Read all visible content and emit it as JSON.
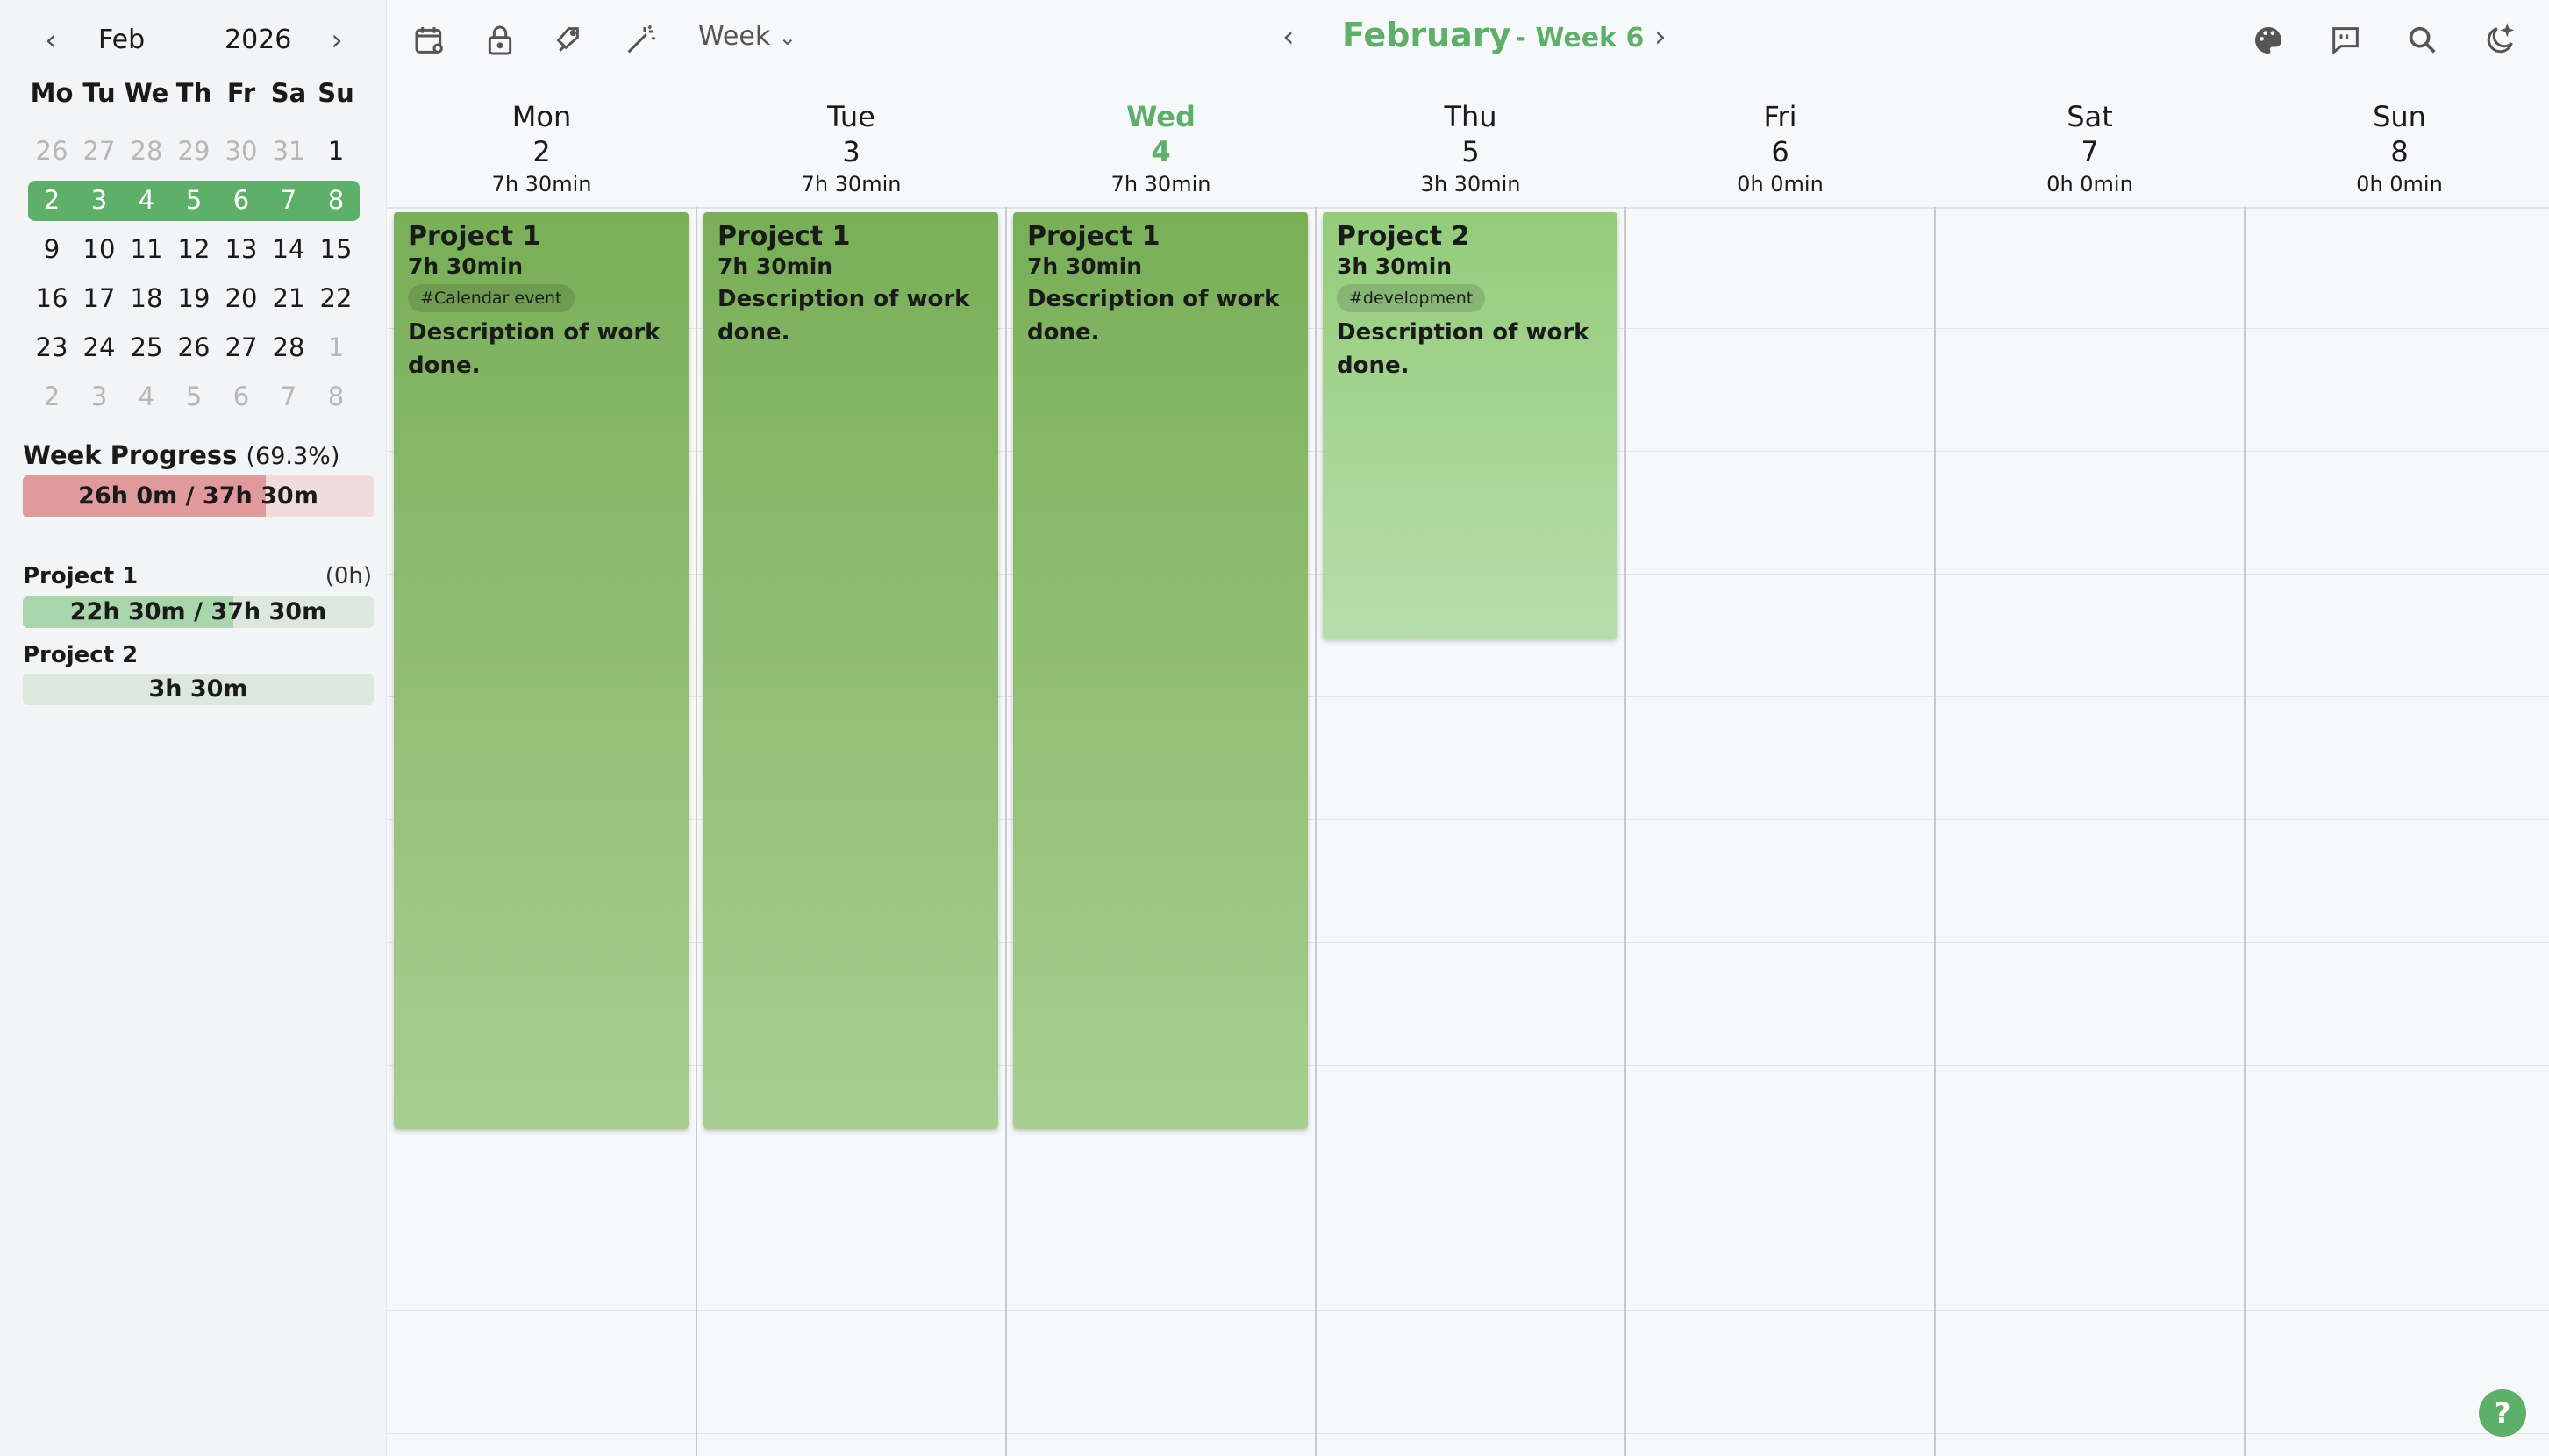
{
  "mini_calendar": {
    "month": "Feb",
    "year": "2026",
    "prev": "‹",
    "next": "›",
    "weekdays": [
      "Mo",
      "Tu",
      "We",
      "Th",
      "Fr",
      "Sa",
      "Su"
    ],
    "weeks": [
      [
        "26",
        "27",
        "28",
        "29",
        "30",
        "31",
        "1"
      ],
      [
        "2",
        "3",
        "4",
        "5",
        "6",
        "7",
        "8"
      ],
      [
        "9",
        "10",
        "11",
        "12",
        "13",
        "14",
        "15"
      ],
      [
        "16",
        "17",
        "18",
        "19",
        "20",
        "21",
        "22"
      ],
      [
        "23",
        "24",
        "25",
        "26",
        "27",
        "28",
        "1"
      ],
      [
        "2",
        "3",
        "4",
        "5",
        "6",
        "7",
        "8"
      ]
    ]
  },
  "progress": {
    "title": "Week Progress",
    "percent": "(69.3%)",
    "value": "26h 0m / 37h 30m",
    "fraction": 0.693,
    "color": "#e09a9c"
  },
  "projects": [
    {
      "name": "Project 1",
      "side": "(0h)",
      "value": "22h 30m / 37h 30m",
      "fraction": 0.6,
      "color": "#a8d5ab"
    },
    {
      "name": "Project 2",
      "side": "",
      "value": "3h 30m",
      "fraction": 0.0,
      "color": "#cfe9d3"
    }
  ],
  "toolbar": {
    "view": "Week",
    "view_caret": "⌄",
    "title": "February",
    "subtitle": "- Week 6",
    "prev": "‹",
    "next": "›",
    "icons": [
      "calendar-settings-icon",
      "lock-icon",
      "tags-icon",
      "magic-wand-icon",
      "palette-icon",
      "feedback-icon",
      "search-icon",
      "dark-mode-icon"
    ]
  },
  "days": [
    {
      "name": "Mon",
      "date": "2",
      "hours": "7h 30min"
    },
    {
      "name": "Tue",
      "date": "3",
      "hours": "7h 30min"
    },
    {
      "name": "Wed",
      "date": "4",
      "hours": "7h 30min",
      "today": true
    },
    {
      "name": "Thu",
      "date": "5",
      "hours": "3h 30min"
    },
    {
      "name": "Fri",
      "date": "6",
      "hours": "0h 0min"
    },
    {
      "name": "Sat",
      "date": "7",
      "hours": "0h 0min"
    },
    {
      "name": "Sun",
      "date": "8",
      "hours": "0h 0min"
    }
  ],
  "events": [
    {
      "title": "Project 1",
      "duration": "7h 30min",
      "tag": "#Calendar event",
      "description": "Description of work done.",
      "color_top": "#79af58",
      "color_bottom": "#a7cf90"
    },
    {
      "title": "Project 1",
      "duration": "7h 30min",
      "tag": "",
      "description": "Description of work done.",
      "color_top": "#79af58",
      "color_bottom": "#a7cf90"
    },
    {
      "title": "Project 1",
      "duration": "7h 30min",
      "tag": "",
      "description": "Description of work done.",
      "color_top": "#79af58",
      "color_bottom": "#a7cf90"
    },
    {
      "title": "Project 2",
      "duration": "3h 30min",
      "tag": "#development",
      "description": "Description of work done.",
      "color_top": "#93cc7b",
      "color_bottom": "#b7deaa"
    }
  ],
  "help": "?"
}
